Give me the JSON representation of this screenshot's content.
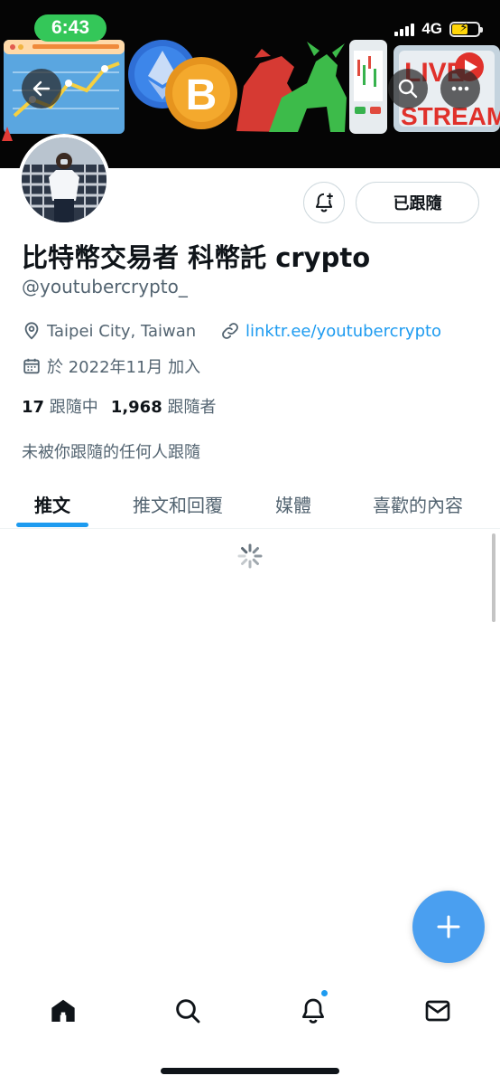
{
  "status_bar": {
    "time": "6:43",
    "network": "4G"
  },
  "banner": {
    "description_icons": [
      "chart-screen-art",
      "ethereum-coin",
      "bitcoin-coin",
      "bear-bull-art",
      "phone-chart-art",
      "live-stream-art"
    ],
    "live_text": "LIVE",
    "stream_text": "STREAM",
    "bitcoin_symbol": "B"
  },
  "profile": {
    "display_name": "比特幣交易者 科幣託 crypto",
    "handle": "@youtubercrypto_",
    "location": "Taipei City, Taiwan",
    "link": "linktr.ee/youtubercrypto",
    "joined": "於 2022年11月 加入",
    "following_count": "17",
    "following_label": "跟隨中",
    "followers_count": "1,968",
    "followers_label": "跟隨者",
    "followed_by_note": "未被你跟隨的任何人跟隨",
    "following_button": "已跟隨"
  },
  "tabs": [
    {
      "label": "推文",
      "active": true
    },
    {
      "label": "推文和回覆",
      "active": false
    },
    {
      "label": "媒體",
      "active": false
    },
    {
      "label": "喜歡的內容",
      "active": false
    }
  ],
  "colors": {
    "accent": "#1d9bf0",
    "fab": "#4a9ff0",
    "status_pill": "#34c759"
  },
  "icons": {
    "back": "arrow-left-icon",
    "search": "search-icon",
    "more": "more-horizontal-icon",
    "notify": "bell-plus-icon",
    "location": "location-pin-icon",
    "link": "link-icon",
    "calendar": "calendar-icon",
    "compose": "plus-icon",
    "nav": [
      "home-icon",
      "search-icon",
      "bell-icon",
      "mail-icon"
    ]
  }
}
